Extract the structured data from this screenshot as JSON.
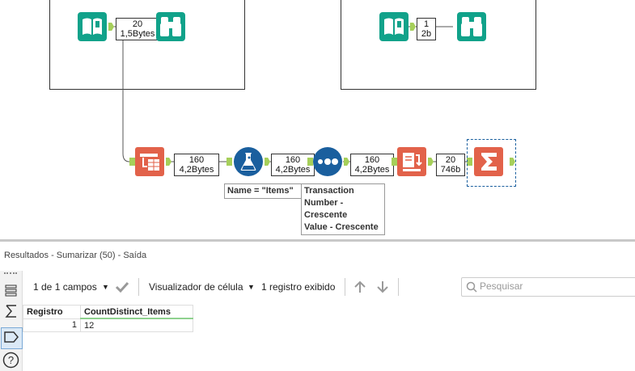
{
  "canvas": {
    "container_left": {
      "count_records": "20",
      "count_size": "1,5Bytes"
    },
    "container_right": {
      "count_records": "1",
      "count_size": "2b"
    },
    "flow": [
      {
        "records": "160",
        "size": "4,2Bytes"
      },
      {
        "records": "160",
        "size": "4,2Bytes"
      },
      {
        "records": "160",
        "size": "4,2Bytes"
      },
      {
        "records": "20",
        "size": "746b"
      }
    ],
    "filter_annotation": "Name = \"Items\"",
    "sort_annotation": [
      "Transaction",
      "Number -",
      "Crescente",
      "Value - Crescente"
    ]
  },
  "results": {
    "title": "Resultados - Sumarizar (50) - Saída",
    "fields_label": "1 de 1 campos",
    "cell_viewer_label": "Visualizador de célula",
    "records_shown": "1 registro exibido",
    "search_placeholder": "Pesquisar",
    "columns": [
      "Registro",
      "CountDistinct_Items"
    ],
    "rows": [
      {
        "registro": "1",
        "value": "12"
      }
    ]
  },
  "colors": {
    "teal": "#11a28a",
    "orange": "#e2624a",
    "blue": "#1a5f9e",
    "anchor_green": "#a6cf5a"
  }
}
